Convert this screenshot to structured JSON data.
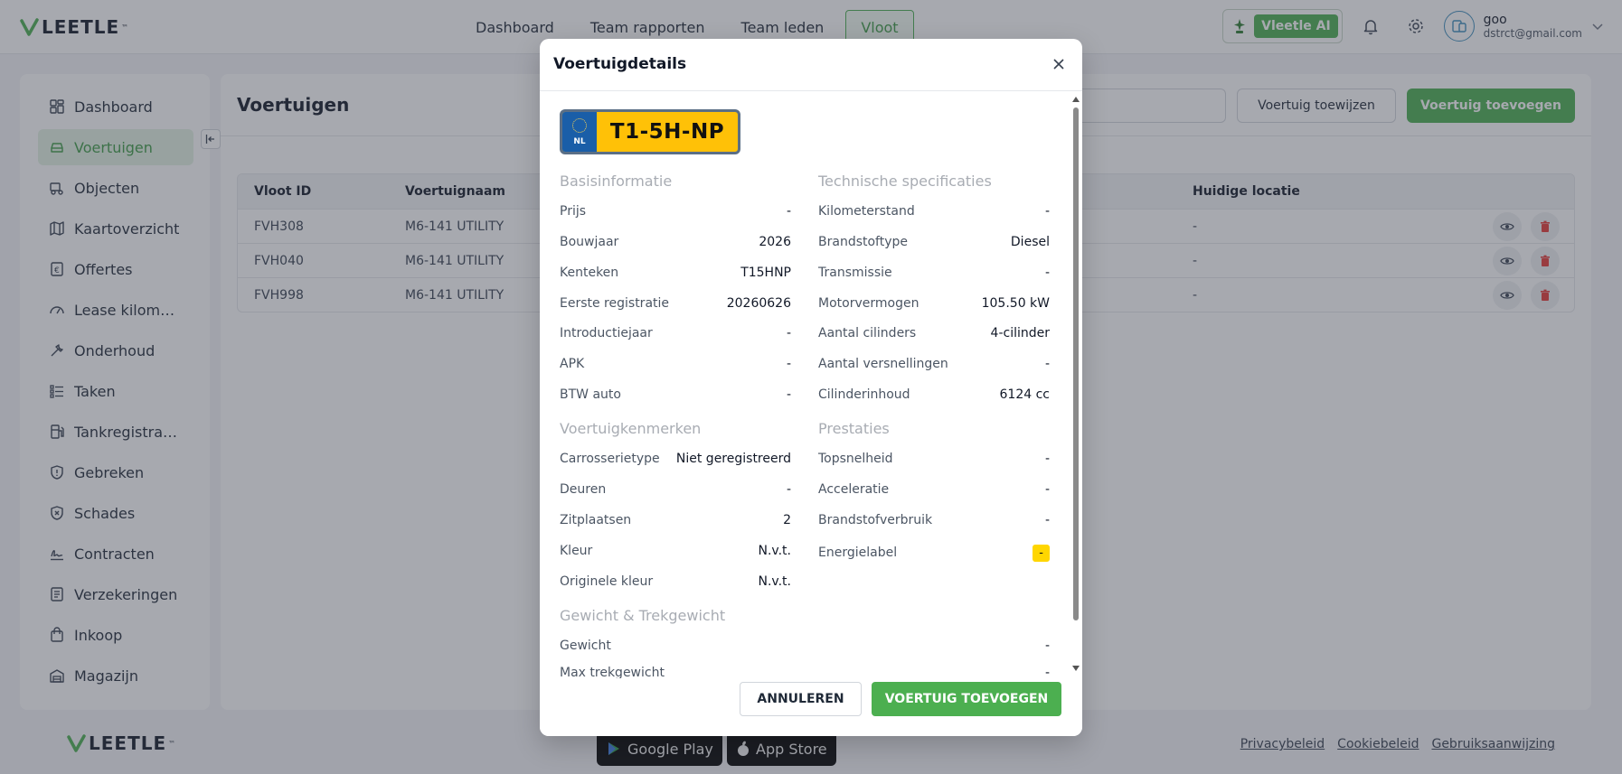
{
  "app": {
    "logo_text": "LEETLE"
  },
  "topnav": {
    "items": [
      {
        "label": "Dashboard",
        "active": false
      },
      {
        "label": "Team rapporten",
        "active": false
      },
      {
        "label": "Team leden",
        "active": false
      },
      {
        "label": "Vloot",
        "active": true
      }
    ]
  },
  "header": {
    "ai_label": "Vleetle AI",
    "user_name": "goo",
    "user_email": "dstrct@gmail.com"
  },
  "sidebar": {
    "items": [
      {
        "label": "Dashboard",
        "icon": "dashboard-icon",
        "active": false
      },
      {
        "label": "Voertuigen",
        "icon": "car-icon",
        "active": true
      },
      {
        "label": "Objecten",
        "icon": "objects-icon",
        "active": false
      },
      {
        "label": "Kaartoverzicht",
        "icon": "map-icon",
        "active": false
      },
      {
        "label": "Offertes",
        "icon": "quote-icon",
        "active": false
      },
      {
        "label": "Lease kilometers",
        "icon": "gauge-icon",
        "active": false
      },
      {
        "label": "Onderhoud",
        "icon": "wrench-icon",
        "active": false
      },
      {
        "label": "Taken",
        "icon": "tasks-icon",
        "active": false
      },
      {
        "label": "Tankregistraties",
        "icon": "fuel-icon",
        "active": false
      },
      {
        "label": "Gebreken",
        "icon": "shield-alert-icon",
        "active": false
      },
      {
        "label": "Schades",
        "icon": "shield-x-icon",
        "active": false
      },
      {
        "label": "Contracten",
        "icon": "signature-icon",
        "active": false
      },
      {
        "label": "Verzekeringen",
        "icon": "document-icon",
        "active": false
      },
      {
        "label": "Inkoop",
        "icon": "shopping-bag-icon",
        "active": false
      },
      {
        "label": "Magazijn",
        "icon": "warehouse-icon",
        "active": false
      }
    ]
  },
  "main": {
    "title": "Voertuigen",
    "search_value": "",
    "assign_button": "Voertuig toewijzen",
    "add_button": "Voertuig toevoegen",
    "table": {
      "headers": [
        "Vloot ID",
        "Voertuignaam",
        "Huidige locatie"
      ],
      "rows": [
        {
          "id": "FVH308",
          "name": "M6-141 UTILITY",
          "location": "-"
        },
        {
          "id": "FVH040",
          "name": "M6-141 UTILITY",
          "location": "-"
        },
        {
          "id": "FVH998",
          "name": "M6-141 UTILITY",
          "location": "-"
        }
      ]
    }
  },
  "modal": {
    "title": "Voertuigdetails",
    "plate": {
      "country": "NL",
      "text": "T1-5H-NP"
    },
    "sections": {
      "basis": {
        "title": "Basisinformatie",
        "fields": [
          {
            "label": "Prijs",
            "value": "-"
          },
          {
            "label": "Bouwjaar",
            "value": "2026"
          },
          {
            "label": "Kenteken",
            "value": "T15HNP"
          },
          {
            "label": "Eerste registratie",
            "value": "20260626"
          },
          {
            "label": "Introductiejaar",
            "value": "-"
          },
          {
            "label": "APK",
            "value": "-"
          },
          {
            "label": "BTW auto",
            "value": "-"
          }
        ]
      },
      "tech": {
        "title": "Technische specificaties",
        "fields": [
          {
            "label": "Kilometerstand",
            "value": "-"
          },
          {
            "label": "Brandstoftype",
            "value": "Diesel"
          },
          {
            "label": "Transmissie",
            "value": "-"
          },
          {
            "label": "Motorvermogen",
            "value": "105.50 kW"
          },
          {
            "label": "Aantal cilinders",
            "value": "4-cilinder"
          },
          {
            "label": "Aantal versnellingen",
            "value": "-"
          },
          {
            "label": "Cilinderinhoud",
            "value": "6124 cc"
          }
        ]
      },
      "kenmerken": {
        "title": "Voertuigkenmerken",
        "fields": [
          {
            "label": "Carrosserietype",
            "value": "Niet geregistreerd"
          },
          {
            "label": "Deuren",
            "value": "-"
          },
          {
            "label": "Zitplaatsen",
            "value": "2"
          },
          {
            "label": "Kleur",
            "value": "N.v.t."
          },
          {
            "label": "Originele kleur",
            "value": "N.v.t."
          }
        ]
      },
      "prestaties": {
        "title": "Prestaties",
        "fields": [
          {
            "label": "Topsnelheid",
            "value": "-"
          },
          {
            "label": "Acceleratie",
            "value": "-"
          },
          {
            "label": "Brandstofverbruik",
            "value": "-"
          },
          {
            "label": "Energielabel",
            "value": "-"
          }
        ]
      },
      "gewicht": {
        "title": "Gewicht & Trekgewicht",
        "fields": [
          {
            "label": "Gewicht",
            "value": "-"
          },
          {
            "label": "Max trekgewicht",
            "value": "-"
          }
        ]
      }
    },
    "cancel_button": "ANNULEREN",
    "submit_button": "VOERTUIG TOEVOEGEN"
  },
  "footer": {
    "logo_text": "LEETLE",
    "google_play": "Google Play",
    "app_store": "App Store",
    "links": [
      "Privacybeleid",
      "Cookiebeleid",
      "Gebruiksaanwijzing"
    ]
  },
  "colors": {
    "brand_green": "#4caf50",
    "plate_yellow": "#ffc107",
    "plate_blue": "#1a5ea8",
    "energy_label": "#ffd600"
  }
}
